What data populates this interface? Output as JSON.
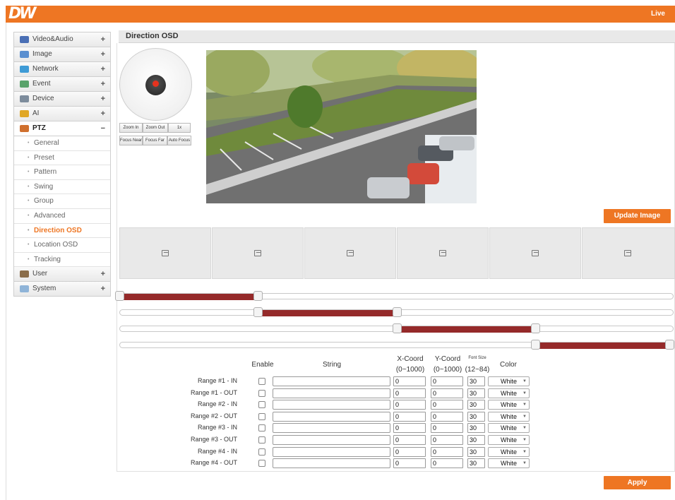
{
  "header": {
    "logo": "DW",
    "live_label": "Live",
    "brand_color": "#ee7623"
  },
  "sidebar": {
    "items": [
      {
        "label": "Video&Audio",
        "toggle": "+",
        "icon": "video-audio-icon"
      },
      {
        "label": "Image",
        "toggle": "+",
        "icon": "image-icon"
      },
      {
        "label": "Network",
        "toggle": "+",
        "icon": "network-icon"
      },
      {
        "label": "Event",
        "toggle": "+",
        "icon": "event-icon"
      },
      {
        "label": "Device",
        "toggle": "+",
        "icon": "device-icon"
      },
      {
        "label": "AI",
        "toggle": "+",
        "icon": "ai-icon"
      },
      {
        "label": "PTZ",
        "toggle": "−",
        "icon": "ptz-icon"
      },
      {
        "label": "User",
        "toggle": "+",
        "icon": "user-icon"
      },
      {
        "label": "System",
        "toggle": "+",
        "icon": "system-icon"
      }
    ],
    "ptz_sub": [
      "General",
      "Preset",
      "Pattern",
      "Swing",
      "Group",
      "Advanced",
      "Direction OSD",
      "Location OSD",
      "Tracking"
    ],
    "current_sub": "Direction OSD"
  },
  "main": {
    "title": "Direction OSD",
    "ptz_buttons": [
      "Zoom In",
      "Zoom Out",
      "1x",
      "Focus Near",
      "Focus Far",
      "Auto Focus"
    ],
    "update_button": "Update Image",
    "apply_button": "Apply",
    "thumbnail_icon": "image-placeholder-icon"
  },
  "ranges_slider": [
    {
      "start": 0.0,
      "end": 0.25
    },
    {
      "start": 0.25,
      "end": 0.5
    },
    {
      "start": 0.5,
      "end": 0.75
    },
    {
      "start": 0.75,
      "end": 1.0
    }
  ],
  "osd_table": {
    "headers": {
      "enable": "Enable",
      "string": "String",
      "xcoord": "X-Coord",
      "xcoord_range": "(0~1000)",
      "ycoord": "Y-Coord",
      "ycoord_range": "(0~1000)",
      "fontsize": "Font Size",
      "fontsize_range": "(12~84)",
      "color": "Color"
    },
    "rows": [
      {
        "label": "Range #1 - IN",
        "enabled": false,
        "string": "",
        "x": "0",
        "y": "0",
        "size": "30",
        "color": "White"
      },
      {
        "label": "Range #1 - OUT",
        "enabled": false,
        "string": "",
        "x": "0",
        "y": "0",
        "size": "30",
        "color": "White"
      },
      {
        "label": "Range #2 - IN",
        "enabled": false,
        "string": "",
        "x": "0",
        "y": "0",
        "size": "30",
        "color": "White"
      },
      {
        "label": "Range #2 - OUT",
        "enabled": false,
        "string": "",
        "x": "0",
        "y": "0",
        "size": "30",
        "color": "White"
      },
      {
        "label": "Range #3 - IN",
        "enabled": false,
        "string": "",
        "x": "0",
        "y": "0",
        "size": "30",
        "color": "White"
      },
      {
        "label": "Range #3 - OUT",
        "enabled": false,
        "string": "",
        "x": "0",
        "y": "0",
        "size": "30",
        "color": "White"
      },
      {
        "label": "Range #4 - IN",
        "enabled": false,
        "string": "",
        "x": "0",
        "y": "0",
        "size": "30",
        "color": "White"
      },
      {
        "label": "Range #4 - OUT",
        "enabled": false,
        "string": "",
        "x": "0",
        "y": "0",
        "size": "30",
        "color": "White"
      }
    ]
  }
}
